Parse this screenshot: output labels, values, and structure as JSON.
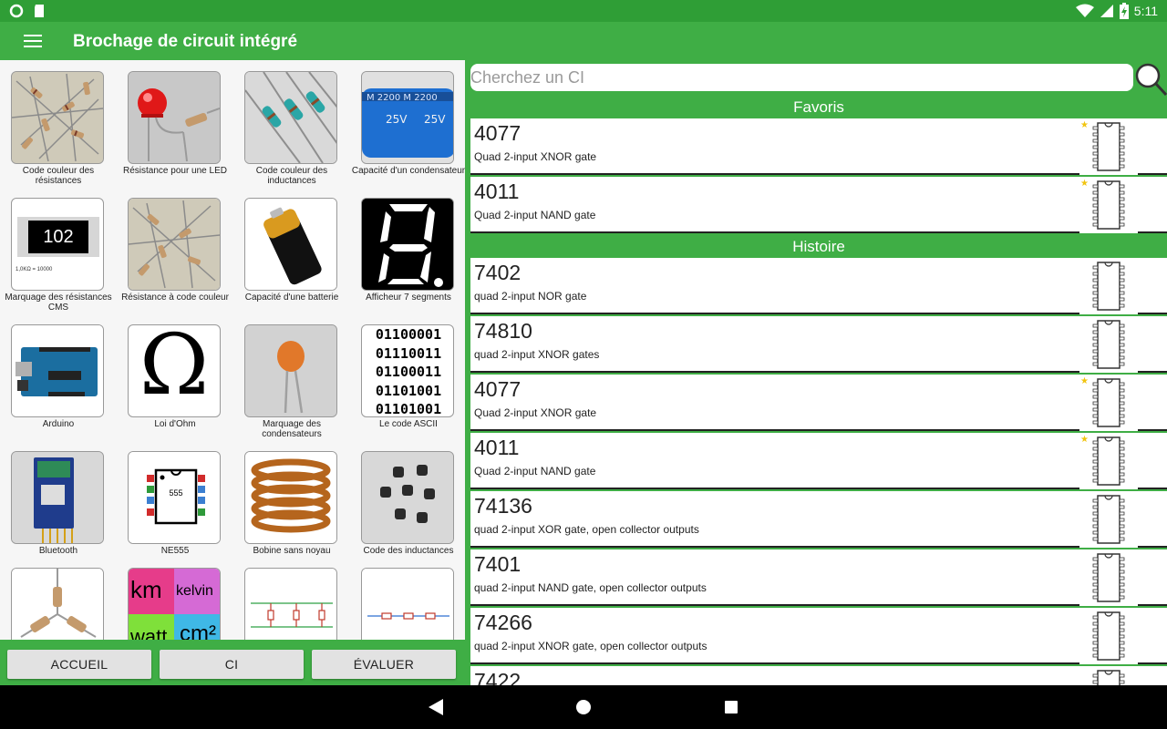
{
  "status": {
    "time": "5:11"
  },
  "app": {
    "title": "Brochage de circuit intégré"
  },
  "tiles": [
    {
      "label": "Code couleur des résistances",
      "img": "resistor-pile"
    },
    {
      "label": "Résistance pour une LED",
      "img": "red-led"
    },
    {
      "label": "Code couleur des inductances",
      "img": "inductors"
    },
    {
      "label": "Capacité d'un condensateur",
      "img": "capacitor",
      "img_text": "25V"
    },
    {
      "label": "Marquage des résistances CMS",
      "img": "smd",
      "img_text": "102",
      "img_sub": "1,0KΩ = 10000"
    },
    {
      "label": "Résistance à code couleur",
      "img": "resistor-pile"
    },
    {
      "label": "Capacité d'une batterie",
      "img": "battery"
    },
    {
      "label": "Afficheur 7 segments",
      "img": "seven-seg"
    },
    {
      "label": "Arduino",
      "img": "arduino"
    },
    {
      "label": "Loi d'Ohm",
      "img": "omega",
      "img_text": "Ω"
    },
    {
      "label": "Marquage des condensateurs",
      "img": "ceramic-cap"
    },
    {
      "label": "Le code ASCII",
      "img": "ascii",
      "img_lines": [
        "01100001",
        "01110011",
        "01100011",
        "01101001",
        "01101001"
      ]
    },
    {
      "label": "Bluetooth",
      "img": "bluetooth"
    },
    {
      "label": "NE555",
      "img": "ne555",
      "img_text": "555"
    },
    {
      "label": "Bobine sans noyau",
      "img": "coil"
    },
    {
      "label": "Code des inductances",
      "img": "smd-inductors"
    },
    {
      "label": "",
      "img": "star-resistors"
    },
    {
      "label": "",
      "img": "units",
      "img_words": [
        "km",
        "kelvin",
        "watt",
        "cm²"
      ]
    },
    {
      "label": "",
      "img": "parallel-circuit"
    },
    {
      "label": "",
      "img": "series-circuit"
    }
  ],
  "bottom_buttons": [
    "ACCUEIL",
    "CI",
    "ÉVALUER"
  ],
  "search": {
    "placeholder": "Cherchez un CI"
  },
  "favorites_header": "Favoris",
  "history_header": "Histoire",
  "favorites": [
    {
      "num": "4077",
      "desc": "Quad 2-input XNOR gate",
      "star": true
    },
    {
      "num": "4011",
      "desc": "Quad 2-input NAND gate",
      "star": true
    }
  ],
  "history": [
    {
      "num": "7402",
      "desc": "quad 2-input NOR gate",
      "star": false
    },
    {
      "num": "74810",
      "desc": "quad 2-input XNOR gates",
      "star": false
    },
    {
      "num": "4077",
      "desc": "Quad 2-input XNOR gate",
      "star": true
    },
    {
      "num": "4011",
      "desc": "Quad 2-input NAND gate",
      "star": true
    },
    {
      "num": "74136",
      "desc": "quad 2-input XOR gate, open collector outputs",
      "star": false
    },
    {
      "num": "7401",
      "desc": "quad 2-input NAND gate, open collector outputs",
      "star": false
    },
    {
      "num": "74266",
      "desc": "quad 2-input XNOR gate, open collector outputs",
      "star": false
    },
    {
      "num": "7422",
      "desc": "",
      "star": false
    }
  ],
  "colors": {
    "primary": "#3fae45",
    "status_bar": "#2f9e36",
    "star": "#f1c40f"
  }
}
